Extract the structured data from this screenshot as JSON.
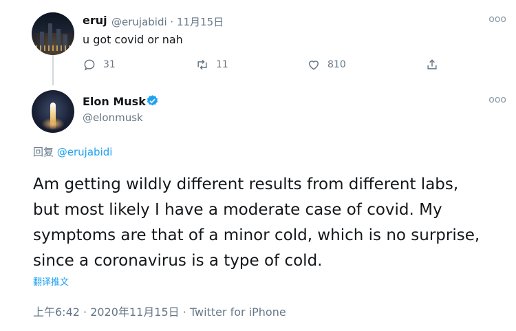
{
  "parent_tweet": {
    "name": "eruj",
    "handle_date": "@erujabidi · 11月15日",
    "text": "u got covid or nah",
    "more": "ooo",
    "reply_count": "31",
    "retweet_count": "11",
    "like_count": "810"
  },
  "main_tweet": {
    "name": "Elon Musk",
    "handle": "@elonmusk",
    "more": "ooo",
    "reply_prefix": "回复 ",
    "reply_handle": "@erujabidi",
    "text": "Am getting wildly different results from different labs,\nbut most likely I have a moderate case of covid. My\nsymptoms are that of a minor cold, which is no surprise,\nsince a coronavirus is a type of cold.",
    "translate": "翻译推文",
    "meta": "上午6:42 · 2020年11月15日 · Twitter for iPhone"
  },
  "colors": {
    "accent": "#1da1f2",
    "secondary_text": "#657786",
    "primary_text": "#14171a"
  },
  "icons": [
    "reply-icon",
    "retweet-icon",
    "like-icon",
    "share-icon",
    "verified-badge-icon",
    "more-icon"
  ]
}
